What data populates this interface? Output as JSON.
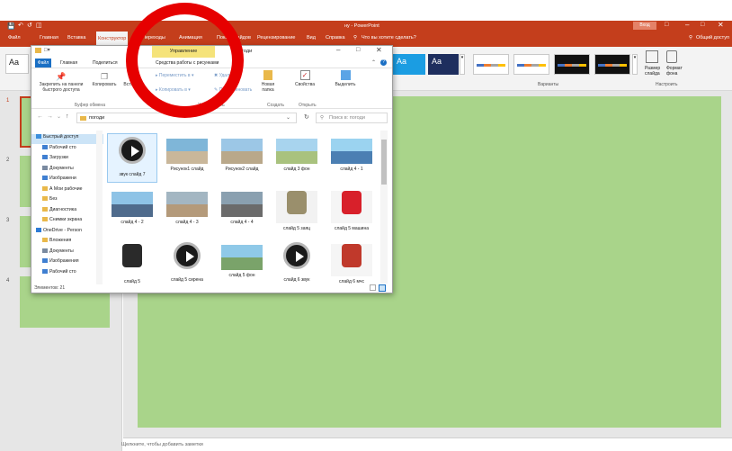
{
  "powerpoint": {
    "title": "ну - PowerPoint",
    "sign_in": "Вход",
    "tabs": [
      "Файл",
      "Главная",
      "Вставка",
      "Конструктор",
      "Переходы",
      "Анимация",
      "Показ слайдов",
      "Рецензирование",
      "Вид",
      "Справка"
    ],
    "tell_me": "Что вы хотите сделать?",
    "share": "Общий доступ",
    "group_variants": "Варианты",
    "group_customize": "Настроить",
    "slide_size": "Размер слайда",
    "format_bg": "Формат фона",
    "theme_aa": "Aa",
    "notes_placeholder": "Щелкните, чтобы добавить заметки",
    "slide_numbers": [
      "1",
      "2",
      "3",
      "4"
    ]
  },
  "explorer": {
    "manage_tab": "Управление",
    "folder_title": "погоди",
    "tabs": [
      "Файл",
      "Главная",
      "Поделиться",
      "Вид",
      "Средства работы с рисунками"
    ],
    "ribbon": {
      "pin": "Закрепить на панели быстрого доступа",
      "copy": "Копировать",
      "paste": "Вставить",
      "move": "Переместить в",
      "copy_to": "Копировать в",
      "delete": "Удалить",
      "rename": "Переименовать",
      "new_folder": "Новая папка",
      "properties": "Свойства",
      "select": "Выделить",
      "group_clipboard": "Буфер обмена",
      "group_organize": "Упорядочить",
      "group_create": "Создать",
      "group_open": "Открыть"
    },
    "address": "погоди",
    "search_placeholder": "Поиск в: погоди",
    "status": "Элементов: 21",
    "nav": [
      {
        "label": "Быстрый доступ",
        "color": "#3c8fdc"
      },
      {
        "label": "Рабочий сто",
        "color": "#3f7fd1"
      },
      {
        "label": "Загрузки",
        "color": "#3f7fd1"
      },
      {
        "label": "Документы",
        "color": "#7a8aa0"
      },
      {
        "label": "Изображени",
        "color": "#3f7fd1"
      },
      {
        "label": "А Мои рабочие",
        "color": "#e9b84a"
      },
      {
        "label": "Без",
        "color": "#e9b84a"
      },
      {
        "label": "Диагностика",
        "color": "#e9b84a"
      },
      {
        "label": "Снимки экрана",
        "color": "#e9b84a"
      },
      {
        "label": "OneDrive - Person",
        "color": "#2e7bd6"
      },
      {
        "label": "Вложения",
        "color": "#e9b84a"
      },
      {
        "label": "Документы",
        "color": "#7a8aa0"
      },
      {
        "label": "Изображения",
        "color": "#3f7fd1"
      },
      {
        "label": "Рабочий сто",
        "color": "#3f7fd1"
      }
    ],
    "files": [
      {
        "label": "звук слайд 7",
        "kind": "video"
      },
      {
        "label": "Рисунок1 слайд",
        "kind": "scene",
        "c1": "#7fb6d8",
        "c2": "#c9b79a"
      },
      {
        "label": "Рисунок2 слайд",
        "kind": "scene",
        "c1": "#9cc7e6",
        "c2": "#b9a88a"
      },
      {
        "label": "слайд 3 фон",
        "kind": "scene",
        "c1": "#a8d4ee",
        "c2": "#a9c27e"
      },
      {
        "label": "слайд 4 - 1",
        "kind": "scene",
        "c1": "#9bd3f0",
        "c2": "#4b7fb3"
      },
      {
        "label": "слайд 4 - 2",
        "kind": "scene",
        "c1": "#8ec3e6",
        "c2": "#4f6b8c"
      },
      {
        "label": "слайд 4 - 3",
        "kind": "scene",
        "c1": "#a3b6c2",
        "c2": "#b49a7a"
      },
      {
        "label": "слайд 4 - 4",
        "kind": "scene",
        "c1": "#8aa0b0",
        "c2": "#6b6b6b"
      },
      {
        "label": "слайд 5 заяц",
        "kind": "figure",
        "c1": "#f2f2f2",
        "c2": "#9a8f6c"
      },
      {
        "label": "слайд 5 машина",
        "kind": "figure",
        "c1": "#f5f5f5",
        "c2": "#d8202a"
      },
      {
        "label": "слайд 5",
        "kind": "figure",
        "c1": "#ffffff",
        "c2": "#2a2a2a"
      },
      {
        "label": "слайд 5 сирена",
        "kind": "video"
      },
      {
        "label": "слайд 5 фон",
        "kind": "scene",
        "c1": "#8fc9e8",
        "c2": "#7aa36a"
      },
      {
        "label": "слайд 6 звук",
        "kind": "video"
      },
      {
        "label": "слайд 6 мчс",
        "kind": "figure",
        "c1": "#f5f5f5",
        "c2": "#c0392b"
      }
    ]
  }
}
